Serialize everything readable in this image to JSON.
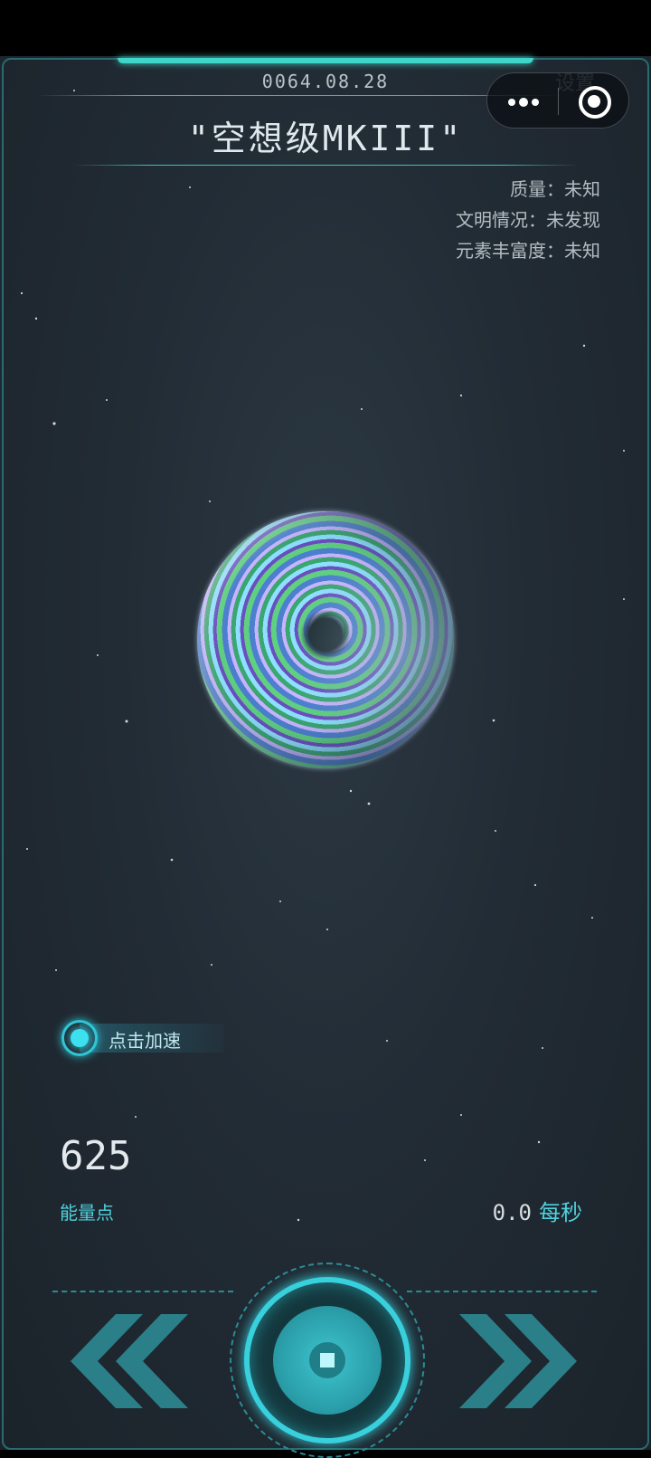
{
  "header": {
    "date": "0064.08.28",
    "planet_name": "\"空想级MKIII\"",
    "settings_label": "设置"
  },
  "planet_info": {
    "mass": "质量：未知",
    "civilization": "文明情况：未发现",
    "element_richness": "元素丰富度：未知"
  },
  "accelerate": {
    "label": "点击加速"
  },
  "stats": {
    "energy_points": "625",
    "energy_label": "能量点",
    "rate_value": "0.0",
    "rate_unit": "每秒"
  },
  "colors": {
    "accent": "#37d0dc",
    "text_accent": "#4fd1de",
    "background": "#222c35"
  },
  "icons": {
    "more": "more-icon",
    "close": "close-target-icon",
    "accelerate": "pulse-icon",
    "prev": "double-chevron-left-icon",
    "next": "double-chevron-right-icon"
  }
}
